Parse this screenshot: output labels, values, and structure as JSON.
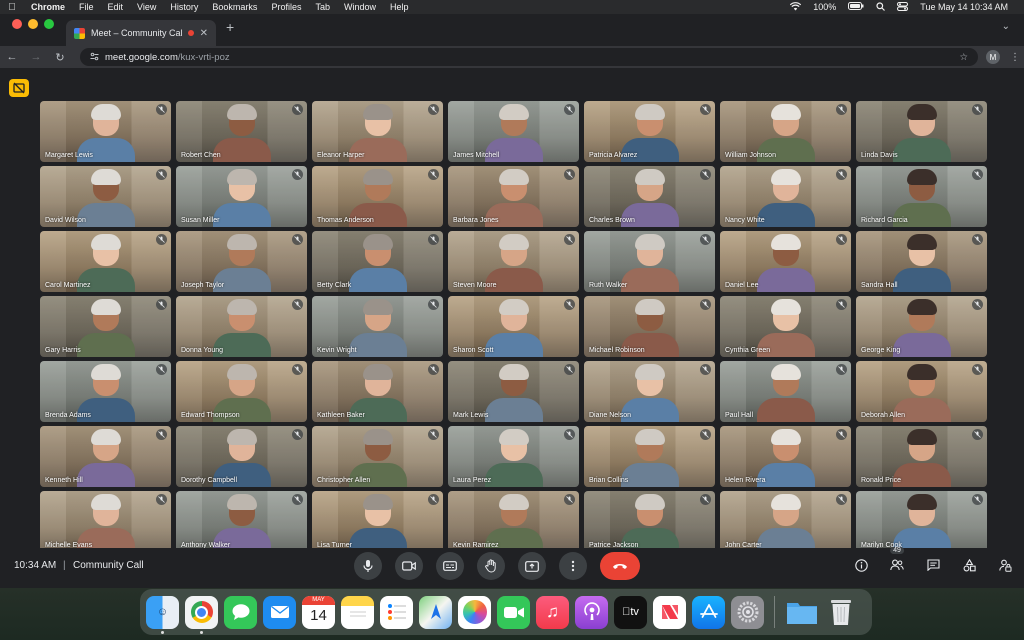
{
  "menubar": {
    "app_name": "Chrome",
    "items": [
      "File",
      "Edit",
      "View",
      "History",
      "Bookmarks",
      "Profiles",
      "Tab",
      "Window",
      "Help"
    ],
    "battery": "100%",
    "datetime": "Tue May 14  10:34 AM"
  },
  "browser": {
    "tab_title": "Meet – Community Call",
    "url_host": "meet.google.com",
    "url_path": "/kux-vrti-poz",
    "profile_initial": "M"
  },
  "meeting": {
    "time": "10:34 AM",
    "separator": "|",
    "name": "Community Call",
    "participant_count": "49",
    "participants": [
      "Margaret Lewis",
      "Robert Chen",
      "Eleanor Harper",
      "James Mitchell",
      "Patricia Alvarez",
      "William Johnson",
      "Linda Davis",
      "David Wilson",
      "Susan Miller",
      "Thomas Anderson",
      "Barbara Jones",
      "Charles Brown",
      "Nancy White",
      "Richard Garcia",
      "Carol Martinez",
      "Joseph Taylor",
      "Betty Clark",
      "Steven Moore",
      "Ruth Walker",
      "Daniel Lee",
      "Sandra Hall",
      "Gary Harris",
      "Donna Young",
      "Kevin Wright",
      "Sharon Scott",
      "Michael Robinson",
      "Cynthia Green",
      "George King",
      "Brenda Adams",
      "Edward Thompson",
      "Kathleen Baker",
      "Mark Lewis",
      "Diane Nelson",
      "Paul Hall",
      "Deborah Allen",
      "Kenneth Hill",
      "Dorothy Campbell",
      "Christopher Allen",
      "Laura Perez",
      "Brian Collins",
      "Helen Rivera",
      "Ronald Price",
      "Michelle Evans",
      "Anthony Walker",
      "Lisa Turner",
      "Kevin Ramirez",
      "Patrice Jackson",
      "John Carter",
      "Marilyn Cook"
    ]
  },
  "dock": {
    "calendar_month": "MAY",
    "calendar_day": "14",
    "tv_label": "tv"
  },
  "colors": {
    "leave_button": "#ea4335",
    "raise_hand_badge": "#fbbc04"
  }
}
